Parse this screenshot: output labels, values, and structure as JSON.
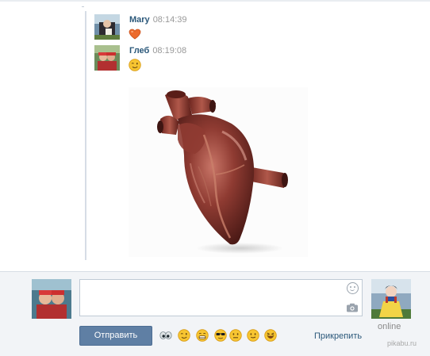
{
  "messages": [
    {
      "author": "Mary",
      "time": "08:14:39",
      "content_emoji": "orange-heart"
    },
    {
      "author": "Глеб",
      "time": "08:19:08",
      "content_emoji": "winking-face",
      "attachment": "anatomical-heart-photo"
    }
  ],
  "composer": {
    "send_label": "Отправить",
    "attach_label": "Прикрепить",
    "quick_emojis": [
      "alien-eyes",
      "wink",
      "grin",
      "sunglasses",
      "neutral",
      "smirk",
      "laughing"
    ]
  },
  "peer": {
    "status": "online"
  },
  "watermark": "pikabu.ru",
  "colors": {
    "link": "#2b587a",
    "button": "#5f7fa4",
    "composer_bg": "#f2f4f7",
    "emoji_yellow": "#f7c531"
  }
}
